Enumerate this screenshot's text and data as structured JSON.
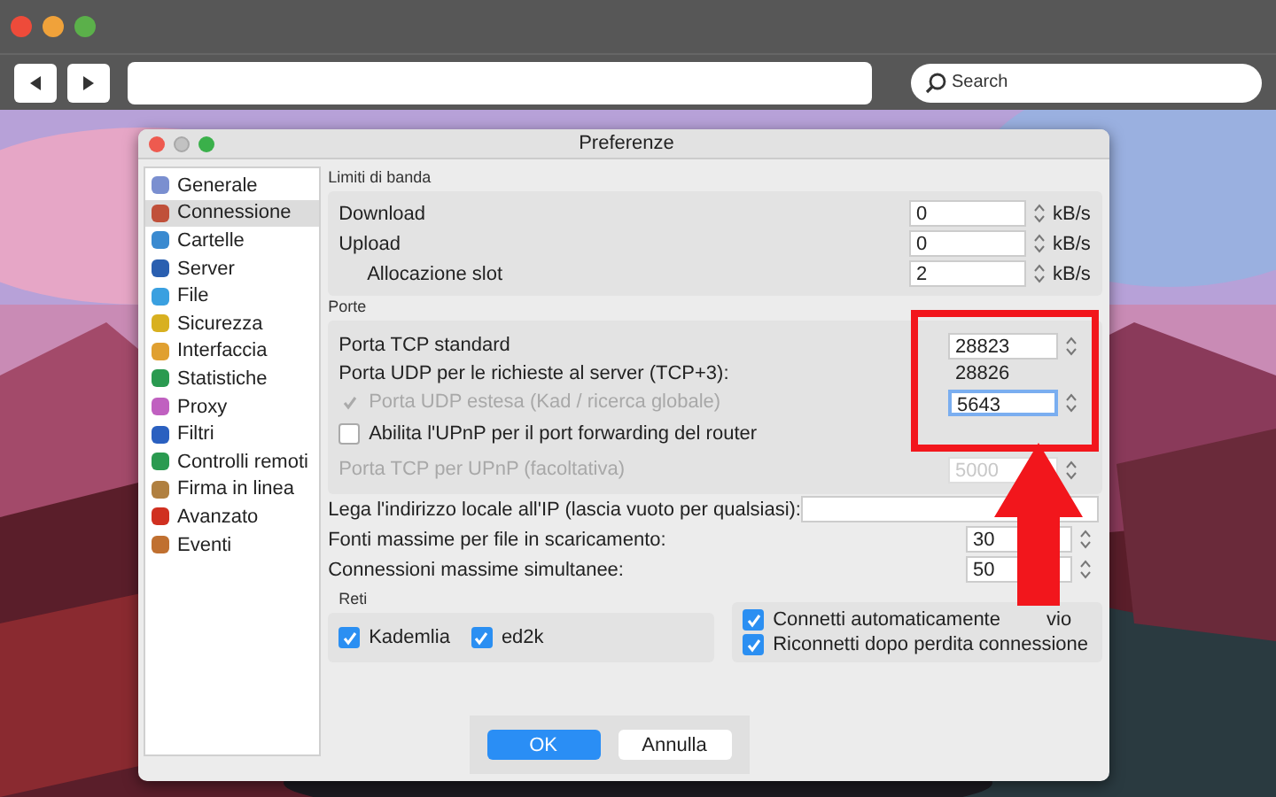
{
  "browser": {
    "search": {
      "placeholder": "Search"
    }
  },
  "window": {
    "title": "Preferenze"
  },
  "sidebar": {
    "items": [
      {
        "label": "Generale",
        "selected": false
      },
      {
        "label": "Connessione",
        "selected": true
      },
      {
        "label": "Cartelle",
        "selected": false
      },
      {
        "label": "Server",
        "selected": false
      },
      {
        "label": "File",
        "selected": false
      },
      {
        "label": "Sicurezza",
        "selected": false
      },
      {
        "label": "Interfaccia",
        "selected": false
      },
      {
        "label": "Statistiche",
        "selected": false
      },
      {
        "label": "Proxy",
        "selected": false
      },
      {
        "label": "Filtri",
        "selected": false
      },
      {
        "label": "Controlli remoti",
        "selected": false
      },
      {
        "label": "Firma in linea",
        "selected": false
      },
      {
        "label": "Avanzato",
        "selected": false
      },
      {
        "label": "Eventi",
        "selected": false
      }
    ]
  },
  "bandwidth": {
    "title": "Limiti di banda",
    "rows": [
      {
        "kind": "main",
        "label": "Download",
        "value": "0",
        "unit": "kB/s"
      },
      {
        "kind": "main",
        "label": "Upload",
        "value": "0",
        "unit": "kB/s"
      },
      {
        "kind": "sub",
        "label": "Allocazione slot",
        "value": "2",
        "unit": "kB/s"
      }
    ]
  },
  "ports": {
    "title": "Porte",
    "rows": [
      {
        "kind": "field",
        "label": "Porta TCP standard",
        "value": "28823",
        "disabled": false
      },
      {
        "kind": "readout",
        "label": "Porta UDP per le richieste al server (TCP+3):",
        "value": "28826"
      },
      {
        "kind": "check-field",
        "label": "Porta UDP estesa (Kad / ricerca globale)",
        "checked": true,
        "disabled": true,
        "value": "5643",
        "focused": true
      },
      {
        "kind": "check",
        "label": "Abilita l'UPnP per il port forwarding del router",
        "checked": false,
        "disabled": false
      },
      {
        "kind": "field",
        "label": "Porta TCP per UPnP (facoltativa)",
        "value": "5000",
        "disabled": true
      }
    ]
  },
  "general": [
    {
      "kind": "text",
      "label": "Lega l'indirizzo locale all'IP (lascia vuoto per qualsiasi):"
    },
    {
      "kind": "spin",
      "label": "Fonti massime per file in scaricamento:",
      "value": "30"
    },
    {
      "kind": "spin",
      "label": "Connessioni massime simultanee:",
      "value": "50"
    }
  ],
  "networks": {
    "title": "Reti",
    "items": [
      {
        "label": "Kademlia",
        "checked": true
      },
      {
        "label": "ed2k",
        "checked": true
      }
    ]
  },
  "connect": [
    {
      "label": "Connetti automaticamente",
      "label_end": "vio",
      "checked": true
    },
    {
      "label": "Riconnetti dopo perdita connessione",
      "checked": true
    }
  ],
  "buttons": [
    {
      "label": "OK",
      "default": true
    },
    {
      "label": "Annulla",
      "default": false
    }
  ]
}
